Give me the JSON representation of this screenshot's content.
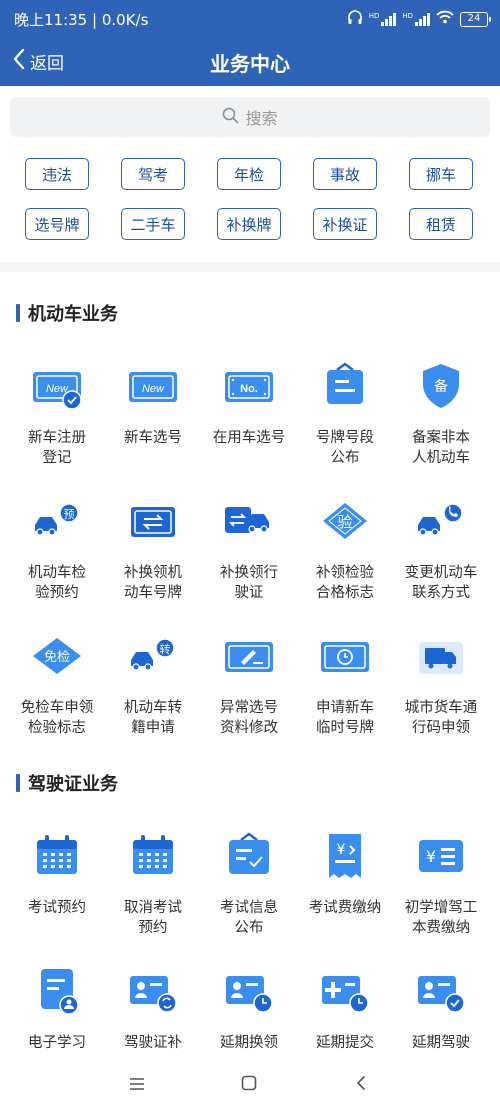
{
  "status_bar": {
    "time_speed": "晚上11:35 | 0.0K/s",
    "battery": "24",
    "hd_label": "HD"
  },
  "nav": {
    "back_label": "返回",
    "title": "业务中心"
  },
  "search": {
    "placeholder": "搜索"
  },
  "quick_tags": [
    "违法",
    "驾考",
    "年检",
    "事故",
    "挪车",
    "选号牌",
    "二手车",
    "补换牌",
    "补换证",
    "租赁"
  ],
  "section_vehicle": {
    "title": "机动车业务",
    "items": [
      {
        "label": "新车注册\n登记",
        "icon": "new-plate-check-icon",
        "badge": "New"
      },
      {
        "label": "新车选号",
        "icon": "new-plate-icon",
        "badge": "New"
      },
      {
        "label": "在用车选号",
        "icon": "plate-number-icon",
        "badge": "No."
      },
      {
        "label": "号牌号段\n公布",
        "icon": "plate-announcement-icon",
        "badge": ""
      },
      {
        "label": "备案非本\n人机动车",
        "icon": "filing-shield-icon",
        "badge": "备"
      },
      {
        "label": "机动车检\n验预约",
        "icon": "car-inspection-booking-icon",
        "badge": "预"
      },
      {
        "label": "补换领机\n动车号牌",
        "icon": "plate-exchange-icon",
        "badge": ""
      },
      {
        "label": "补换领行\n驶证",
        "icon": "license-exchange-car-icon",
        "badge": ""
      },
      {
        "label": "补领检验\n合格标志",
        "icon": "inspection-mark-icon",
        "badge": "验"
      },
      {
        "label": "变更机动车\n联系方式",
        "icon": "car-phone-icon",
        "badge": ""
      },
      {
        "label": "免检车申领\n检验标志",
        "icon": "exempt-inspection-icon",
        "badge": "免检"
      },
      {
        "label": "机动车转\n籍申请",
        "icon": "car-transfer-icon",
        "badge": "转"
      },
      {
        "label": "异常选号\n资料修改",
        "icon": "plate-edit-icon",
        "badge": ""
      },
      {
        "label": "申请新车\n临时号牌",
        "icon": "temporary-plate-icon",
        "badge": ""
      },
      {
        "label": "城市货车通\n行码申领",
        "icon": "truck-pass-icon",
        "badge": ""
      }
    ]
  },
  "section_license": {
    "title": "驾驶证业务",
    "items": [
      {
        "label": "考试预约",
        "icon": "exam-calendar-icon"
      },
      {
        "label": "取消考试\n预约",
        "icon": "cancel-exam-calendar-icon"
      },
      {
        "label": "考试信息\n公布",
        "icon": "exam-info-board-icon"
      },
      {
        "label": "考试费缴纳",
        "icon": "exam-fee-receipt-icon"
      },
      {
        "label": "初学增驾工\n本费缴纳",
        "icon": "fee-card-icon"
      },
      {
        "label": "电子学习",
        "icon": "e-learning-doc-icon"
      },
      {
        "label": "驾驶证补",
        "icon": "license-replace-icon"
      },
      {
        "label": "延期换领",
        "icon": "license-clock-icon"
      },
      {
        "label": "延期提交",
        "icon": "license-plus-clock-icon"
      },
      {
        "label": "延期驾驶",
        "icon": "license-check-icon"
      }
    ]
  },
  "colors": {
    "primary": "#2e63b8",
    "icon_blue": "#3a8ef0",
    "icon_dark": "#1e66d2"
  }
}
